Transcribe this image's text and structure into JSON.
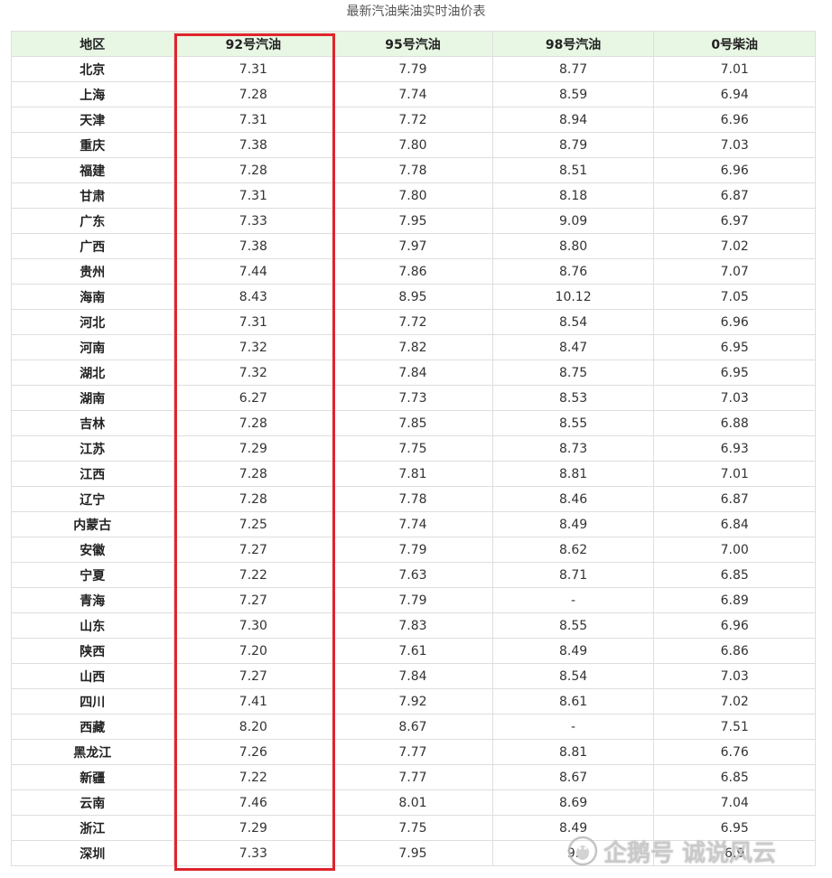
{
  "title": "最新汽油柴油实时油价表",
  "headers": [
    "地区",
    "92号汽油",
    "95号汽油",
    "98号汽油",
    "0号柴油"
  ],
  "rows": [
    [
      "北京",
      "7.31",
      "7.79",
      "8.77",
      "7.01"
    ],
    [
      "上海",
      "7.28",
      "7.74",
      "8.59",
      "6.94"
    ],
    [
      "天津",
      "7.31",
      "7.72",
      "8.94",
      "6.96"
    ],
    [
      "重庆",
      "7.38",
      "7.80",
      "8.79",
      "7.03"
    ],
    [
      "福建",
      "7.28",
      "7.78",
      "8.51",
      "6.96"
    ],
    [
      "甘肃",
      "7.31",
      "7.80",
      "8.18",
      "6.87"
    ],
    [
      "广东",
      "7.33",
      "7.95",
      "9.09",
      "6.97"
    ],
    [
      "广西",
      "7.38",
      "7.97",
      "8.80",
      "7.02"
    ],
    [
      "贵州",
      "7.44",
      "7.86",
      "8.76",
      "7.07"
    ],
    [
      "海南",
      "8.43",
      "8.95",
      "10.12",
      "7.05"
    ],
    [
      "河北",
      "7.31",
      "7.72",
      "8.54",
      "6.96"
    ],
    [
      "河南",
      "7.32",
      "7.82",
      "8.47",
      "6.95"
    ],
    [
      "湖北",
      "7.32",
      "7.84",
      "8.75",
      "6.95"
    ],
    [
      "湖南",
      "6.27",
      "7.73",
      "8.53",
      "7.03"
    ],
    [
      "吉林",
      "7.28",
      "7.85",
      "8.55",
      "6.88"
    ],
    [
      "江苏",
      "7.29",
      "7.75",
      "8.73",
      "6.93"
    ],
    [
      "江西",
      "7.28",
      "7.81",
      "8.81",
      "7.01"
    ],
    [
      "辽宁",
      "7.28",
      "7.78",
      "8.46",
      "6.87"
    ],
    [
      "内蒙古",
      "7.25",
      "7.74",
      "8.49",
      "6.84"
    ],
    [
      "安徽",
      "7.27",
      "7.79",
      "8.62",
      "7.00"
    ],
    [
      "宁夏",
      "7.22",
      "7.63",
      "8.71",
      "6.85"
    ],
    [
      "青海",
      "7.27",
      "7.79",
      "-",
      "6.89"
    ],
    [
      "山东",
      "7.30",
      "7.83",
      "8.55",
      "6.96"
    ],
    [
      "陕西",
      "7.20",
      "7.61",
      "8.49",
      "6.86"
    ],
    [
      "山西",
      "7.27",
      "7.84",
      "8.54",
      "7.03"
    ],
    [
      "四川",
      "7.41",
      "7.92",
      "8.61",
      "7.02"
    ],
    [
      "西藏",
      "8.20",
      "8.67",
      "-",
      "7.51"
    ],
    [
      "黑龙江",
      "7.26",
      "7.77",
      "8.81",
      "6.76"
    ],
    [
      "新疆",
      "7.22",
      "7.77",
      "8.67",
      "6.85"
    ],
    [
      "云南",
      "7.46",
      "8.01",
      "8.69",
      "7.04"
    ],
    [
      "浙江",
      "7.29",
      "7.75",
      "8.49",
      "6.95"
    ],
    [
      "深圳",
      "7.33",
      "7.95",
      "9.",
      "6.9"
    ]
  ],
  "watermark": {
    "text": "企鹅号 诚说风云",
    "icon": "penguin-icon"
  },
  "colors": {
    "header_bg": "#e8f7e4",
    "highlight": "#e0242c",
    "border": "#dedede"
  }
}
